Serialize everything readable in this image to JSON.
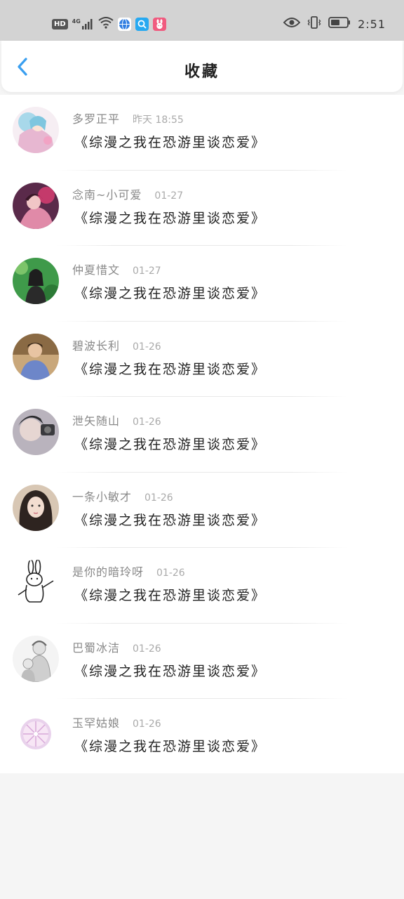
{
  "status_bar": {
    "hd": "HD",
    "network": "4G",
    "time": "2:51",
    "icons": [
      "signal-icon",
      "wifi-icon",
      "browser-app-icon",
      "search-app-icon",
      "rabbit-app-icon",
      "eye-icon",
      "vibrate-icon",
      "battery-icon"
    ]
  },
  "header": {
    "back_icon": "chevron-left-icon",
    "title": "收藏"
  },
  "colors": {
    "accent": "#3a9ff0",
    "status_bar_bg": "#d3d3d3"
  },
  "favorites": [
    {
      "name": "多罗正平",
      "date": "昨天 18:55",
      "book": "《综漫之我在恐游里谈恋爱》"
    },
    {
      "name": "念南~小可爱",
      "date": "01-27",
      "book": "《综漫之我在恐游里谈恋爱》"
    },
    {
      "name": "仲夏惜文",
      "date": "01-27",
      "book": "《综漫之我在恐游里谈恋爱》"
    },
    {
      "name": "碧波长利",
      "date": "01-26",
      "book": "《综漫之我在恐游里谈恋爱》"
    },
    {
      "name": "泄矢随山",
      "date": "01-26",
      "book": "《综漫之我在恐游里谈恋爱》"
    },
    {
      "name": "一条小敏才",
      "date": "01-26",
      "book": "《综漫之我在恐游里谈恋爱》"
    },
    {
      "name": "是你的暗玲呀",
      "date": "01-26",
      "book": "《综漫之我在恐游里谈恋爱》"
    },
    {
      "name": "巴蜀冰洁",
      "date": "01-26",
      "book": "《综漫之我在恐游里谈恋爱》"
    },
    {
      "name": "玉罕姑娘",
      "date": "01-26",
      "book": "《综漫之我在恐游里谈恋爱》"
    }
  ]
}
